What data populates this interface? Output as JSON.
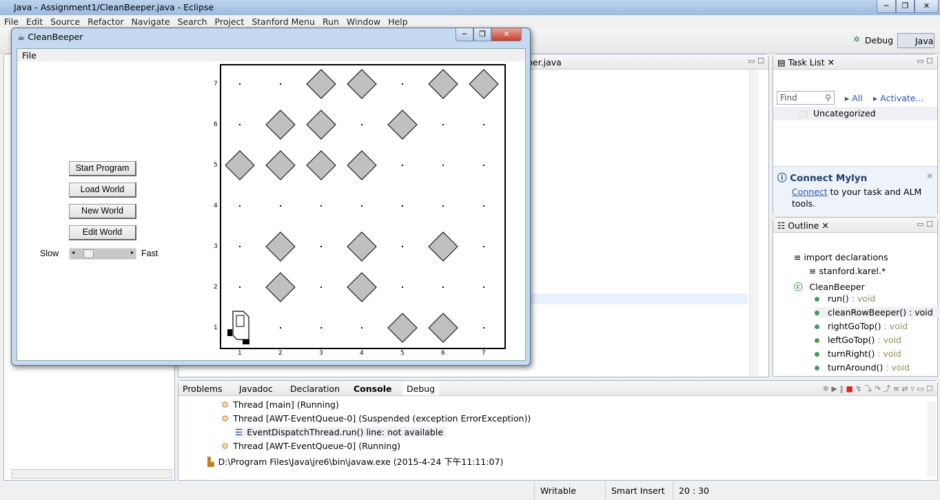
{
  "window": {
    "title": "Java - Assignment1/CleanBeeper.java - Eclipse",
    "min": "─",
    "max": "❐",
    "close": "✕"
  },
  "menu": [
    "File",
    "Edit",
    "Source",
    "Refactor",
    "Navigate",
    "Search",
    "Project",
    "Stanford Menu",
    "Run",
    "Window",
    "Help"
  ],
  "perspectives": {
    "debug": "Debug",
    "java": "Java"
  },
  "editor": {
    "tab": "per.java"
  },
  "task_list": {
    "title": "Task List",
    "find_placeholder": "Find",
    "all": "All",
    "activate": "Activate...",
    "category": "Uncategorized"
  },
  "mylyn": {
    "title": "Connect Mylyn",
    "link": "Connect",
    "text": " to your task and ALM tools."
  },
  "outline": {
    "title": "Outline",
    "items": [
      {
        "name": "import declarations",
        "type": ""
      },
      {
        "name": "stanford.karel.*",
        "type": ""
      },
      {
        "name": "CleanBeeper",
        "type": ""
      },
      {
        "name": "run()",
        "type": " : void"
      },
      {
        "name": "cleanRowBeeper() : void",
        "type": ""
      },
      {
        "name": "rightGoTop()",
        "type": " : void"
      },
      {
        "name": "leftGoTop()",
        "type": " : void"
      },
      {
        "name": "turnRight()",
        "type": " : void"
      },
      {
        "name": "turnAround()",
        "type": " : void"
      }
    ]
  },
  "bottom": {
    "tabs": [
      "Problems",
      "Javadoc",
      "Declaration",
      "Console",
      "Debug"
    ],
    "lines": [
      "Thread [main] (Running)",
      "Thread [AWT-EventQueue-0] (Suspended (exception ErrorException))",
      "EventDispatchThread.run() line: not available",
      "Thread [AWT-EventQueue-0] (Running)",
      "D:\\Program Files\\Java\\jre6\\bin\\javaw.exe (2015-4-24 下午11:11:07)"
    ]
  },
  "statusbar": {
    "writable": "Writable",
    "insert": "Smart Insert",
    "position": "20 : 30"
  },
  "karel_window": {
    "title": "CleanBeeper",
    "menu": "File",
    "buttons": [
      "Start Program",
      "Load World",
      "New World",
      "Edit World"
    ],
    "slow": "Slow",
    "fast": "Fast",
    "speed": 0.1,
    "columns": [
      "1",
      "2",
      "3",
      "4",
      "5",
      "6",
      "7"
    ],
    "rows": [
      "1",
      "2",
      "3",
      "4",
      "5",
      "6",
      "7"
    ],
    "beepers": [
      [
        3,
        7
      ],
      [
        4,
        7
      ],
      [
        6,
        7
      ],
      [
        7,
        7
      ],
      [
        2,
        6
      ],
      [
        3,
        6
      ],
      [
        5,
        6
      ],
      [
        1,
        5
      ],
      [
        2,
        5
      ],
      [
        3,
        5
      ],
      [
        4,
        5
      ],
      [
        2,
        3
      ],
      [
        4,
        3
      ],
      [
        6,
        3
      ],
      [
        2,
        2
      ],
      [
        4,
        2
      ],
      [
        5,
        1
      ],
      [
        6,
        1
      ]
    ],
    "karel": {
      "col": 1,
      "row": 1,
      "facing": "east"
    }
  }
}
